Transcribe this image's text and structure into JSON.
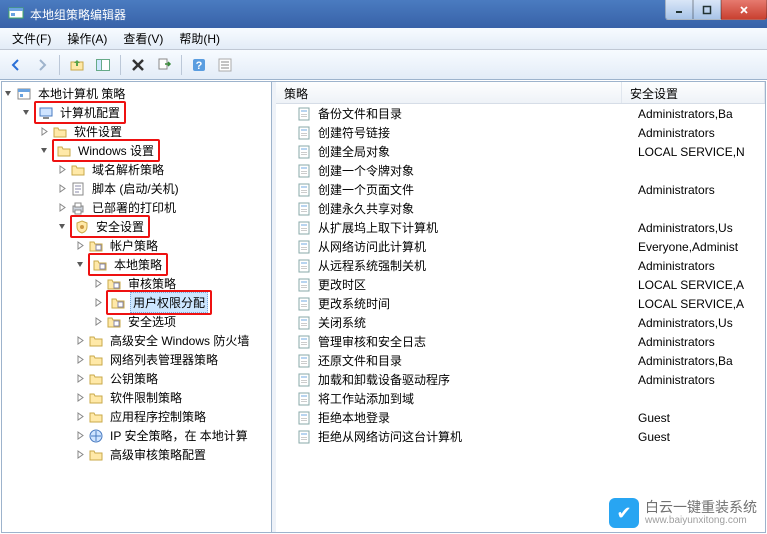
{
  "window": {
    "title": "本地组策略编辑器"
  },
  "menubar": [
    "文件(F)",
    "操作(A)",
    "查看(V)",
    "帮助(H)"
  ],
  "tree": {
    "root": "本地计算机 策略",
    "nodes": [
      {
        "label": "计算机配置",
        "hl": true,
        "expanded": true,
        "icon": "computer"
      },
      {
        "label": "软件设置",
        "indent": 2,
        "icon": "folder"
      },
      {
        "label": "Windows 设置",
        "hl": true,
        "indent": 2,
        "expanded": true,
        "icon": "folder"
      },
      {
        "label": "域名解析策略",
        "indent": 3,
        "icon": "folder"
      },
      {
        "label": "脚本 (启动/关机)",
        "indent": 3,
        "icon": "script"
      },
      {
        "label": "已部署的打印机",
        "indent": 3,
        "icon": "printer"
      },
      {
        "label": "安全设置",
        "hl": true,
        "indent": 3,
        "expanded": true,
        "icon": "shield"
      },
      {
        "label": "帐户策略",
        "indent": 4,
        "icon": "folder-doc"
      },
      {
        "label": "本地策略",
        "hl": true,
        "indent": 4,
        "expanded": true,
        "icon": "folder-doc"
      },
      {
        "label": "审核策略",
        "indent": 5,
        "icon": "folder-doc"
      },
      {
        "label": "用户权限分配",
        "hl": true,
        "indent": 5,
        "selected": true,
        "icon": "folder-doc"
      },
      {
        "label": "安全选项",
        "indent": 5,
        "icon": "folder-doc"
      },
      {
        "label": "高级安全 Windows 防火墙",
        "indent": 4,
        "icon": "folder"
      },
      {
        "label": "网络列表管理器策略",
        "indent": 4,
        "icon": "folder"
      },
      {
        "label": "公钥策略",
        "indent": 4,
        "icon": "folder"
      },
      {
        "label": "软件限制策略",
        "indent": 4,
        "icon": "folder"
      },
      {
        "label": "应用程序控制策略",
        "indent": 4,
        "icon": "folder"
      },
      {
        "label": "IP 安全策略，在 本地计算",
        "indent": 4,
        "icon": "ip"
      },
      {
        "label": "高级审核策略配置",
        "indent": 4,
        "icon": "folder"
      }
    ]
  },
  "list": {
    "columns": [
      "策略",
      "安全设置"
    ],
    "rows": [
      {
        "policy": "备份文件和目录",
        "setting": "Administrators,Ba"
      },
      {
        "policy": "创建符号链接",
        "setting": "Administrators"
      },
      {
        "policy": "创建全局对象",
        "setting": "LOCAL SERVICE,N"
      },
      {
        "policy": "创建一个令牌对象",
        "setting": ""
      },
      {
        "policy": "创建一个页面文件",
        "setting": "Administrators"
      },
      {
        "policy": "创建永久共享对象",
        "setting": ""
      },
      {
        "policy": "从扩展坞上取下计算机",
        "setting": "Administrators,Us"
      },
      {
        "policy": "从网络访问此计算机",
        "setting": "Everyone,Administ"
      },
      {
        "policy": "从远程系统强制关机",
        "setting": "Administrators"
      },
      {
        "policy": "更改时区",
        "setting": "LOCAL SERVICE,A"
      },
      {
        "policy": "更改系统时间",
        "setting": "LOCAL SERVICE,A"
      },
      {
        "policy": "关闭系统",
        "setting": "Administrators,Us"
      },
      {
        "policy": "管理审核和安全日志",
        "setting": "Administrators"
      },
      {
        "policy": "还原文件和目录",
        "setting": "Administrators,Ba"
      },
      {
        "policy": "加载和卸载设备驱动程序",
        "setting": "Administrators"
      },
      {
        "policy": "将工作站添加到域",
        "setting": ""
      },
      {
        "policy": "拒绝本地登录",
        "setting": "Guest"
      },
      {
        "policy": "拒绝从网络访问这台计算机",
        "setting": "Guest"
      }
    ]
  },
  "watermark": {
    "brand": "白云一键重装系统",
    "url": "www.baiyunxitong.com"
  }
}
